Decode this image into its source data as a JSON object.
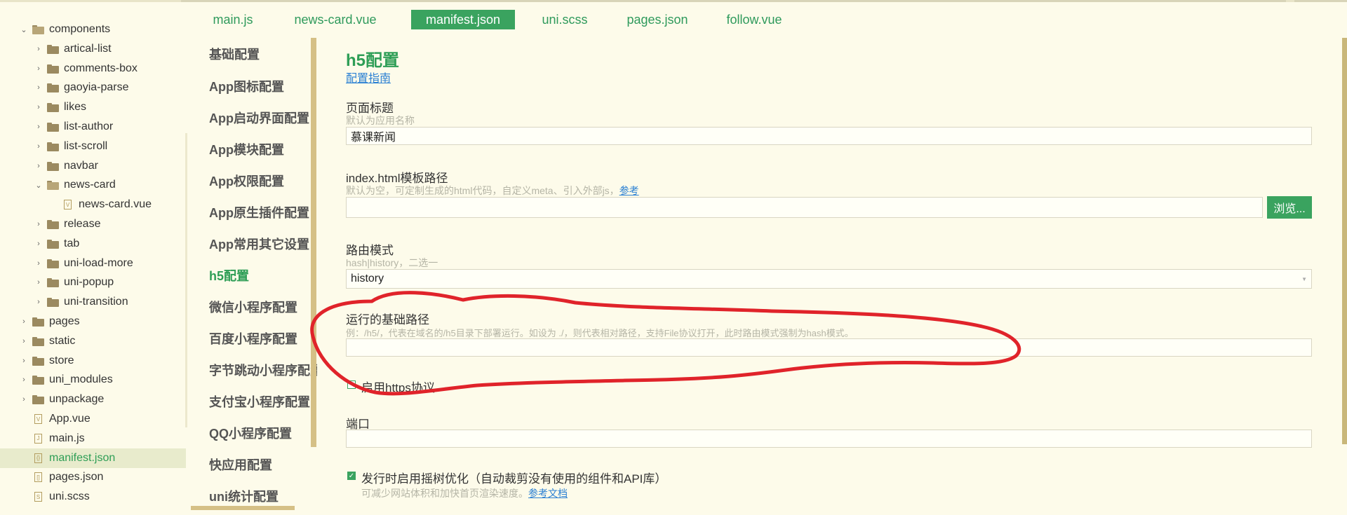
{
  "tabs": [
    "main.js",
    "news-card.vue",
    "manifest.json",
    "uni.scss",
    "pages.json",
    "follow.vue"
  ],
  "active_tab": "manifest.json",
  "tree": [
    {
      "label": "components",
      "type": "folder",
      "expanded": true,
      "depth": 0
    },
    {
      "label": "artical-list",
      "type": "folder",
      "expanded": false,
      "depth": 1
    },
    {
      "label": "comments-box",
      "type": "folder",
      "expanded": false,
      "depth": 1
    },
    {
      "label": "gaoyia-parse",
      "type": "folder",
      "expanded": false,
      "depth": 1
    },
    {
      "label": "likes",
      "type": "folder",
      "expanded": false,
      "depth": 1
    },
    {
      "label": "list-author",
      "type": "folder",
      "expanded": false,
      "depth": 1
    },
    {
      "label": "list-scroll",
      "type": "folder",
      "expanded": false,
      "depth": 1
    },
    {
      "label": "navbar",
      "type": "folder",
      "expanded": false,
      "depth": 1
    },
    {
      "label": "news-card",
      "type": "folder",
      "expanded": true,
      "depth": 1
    },
    {
      "label": "news-card.vue",
      "type": "vue",
      "depth": 2
    },
    {
      "label": "release",
      "type": "folder",
      "expanded": false,
      "depth": 1
    },
    {
      "label": "tab",
      "type": "folder",
      "expanded": false,
      "depth": 1
    },
    {
      "label": "uni-load-more",
      "type": "folder",
      "expanded": false,
      "depth": 1
    },
    {
      "label": "uni-popup",
      "type": "folder",
      "expanded": false,
      "depth": 1
    },
    {
      "label": "uni-transition",
      "type": "folder",
      "expanded": false,
      "depth": 1
    },
    {
      "label": "pages",
      "type": "folder",
      "expanded": false,
      "depth": 0
    },
    {
      "label": "static",
      "type": "folder",
      "expanded": false,
      "depth": 0
    },
    {
      "label": "store",
      "type": "folder",
      "expanded": false,
      "depth": 0
    },
    {
      "label": "uni_modules",
      "type": "folder",
      "expanded": false,
      "depth": 0
    },
    {
      "label": "unpackage",
      "type": "folder",
      "expanded": false,
      "depth": 0
    },
    {
      "label": "App.vue",
      "type": "vue",
      "depth": 0
    },
    {
      "label": "main.js",
      "type": "js",
      "depth": 0
    },
    {
      "label": "manifest.json",
      "type": "json",
      "depth": 0,
      "selected": true
    },
    {
      "label": "pages.json",
      "type": "brackets",
      "depth": 0
    },
    {
      "label": "uni.scss",
      "type": "scss",
      "depth": 0
    }
  ],
  "nav": [
    {
      "label": "基础配置"
    },
    {
      "label": "App图标配置"
    },
    {
      "label": "App启动界面配置"
    },
    {
      "label": "App模块配置"
    },
    {
      "label": "App权限配置"
    },
    {
      "label": "App原生插件配置"
    },
    {
      "label": "App常用其它设置"
    },
    {
      "label": "h5配置",
      "active": true
    },
    {
      "label": "微信小程序配置"
    },
    {
      "label": "百度小程序配置"
    },
    {
      "label": "字节跳动小程序配置"
    },
    {
      "label": "支付宝小程序配置"
    },
    {
      "label": "QQ小程序配置"
    },
    {
      "label": "快应用配置"
    },
    {
      "label": "uni统计配置"
    }
  ],
  "main": {
    "title": "h5配置",
    "guide_link": "配置指南",
    "page_title": {
      "label": "页面标题",
      "hint": "默认为应用名称",
      "value": "慕课新闻"
    },
    "template": {
      "label": "index.html模板路径",
      "hint": "默认为空，可定制生成的html代码，自定义meta、引入外部js，",
      "hint_link": "参考",
      "value": "",
      "browse": "浏览..."
    },
    "router": {
      "label": "路由模式",
      "hint": "hash|history，二选一",
      "value": "history"
    },
    "base": {
      "label": "运行的基础路径",
      "hint": "例：/h5/，代表在域名的/h5目录下部署运行。如设为 ./，则代表相对路径，支持File协议打开，此时路由模式强制为hash模式。",
      "value": ""
    },
    "https": {
      "label": "启用https协议",
      "checked": false
    },
    "port": {
      "label": "端口",
      "value": ""
    },
    "treeshake": {
      "label": "发行时启用摇树优化（自动裁剪没有使用的组件和API库）",
      "checked": true,
      "hint": "可减少网站体积和加快首页渲染速度。",
      "hint_link": "参考文档"
    }
  },
  "colors": {
    "accent": "#3aa35f",
    "annotation": "#e0232a"
  }
}
